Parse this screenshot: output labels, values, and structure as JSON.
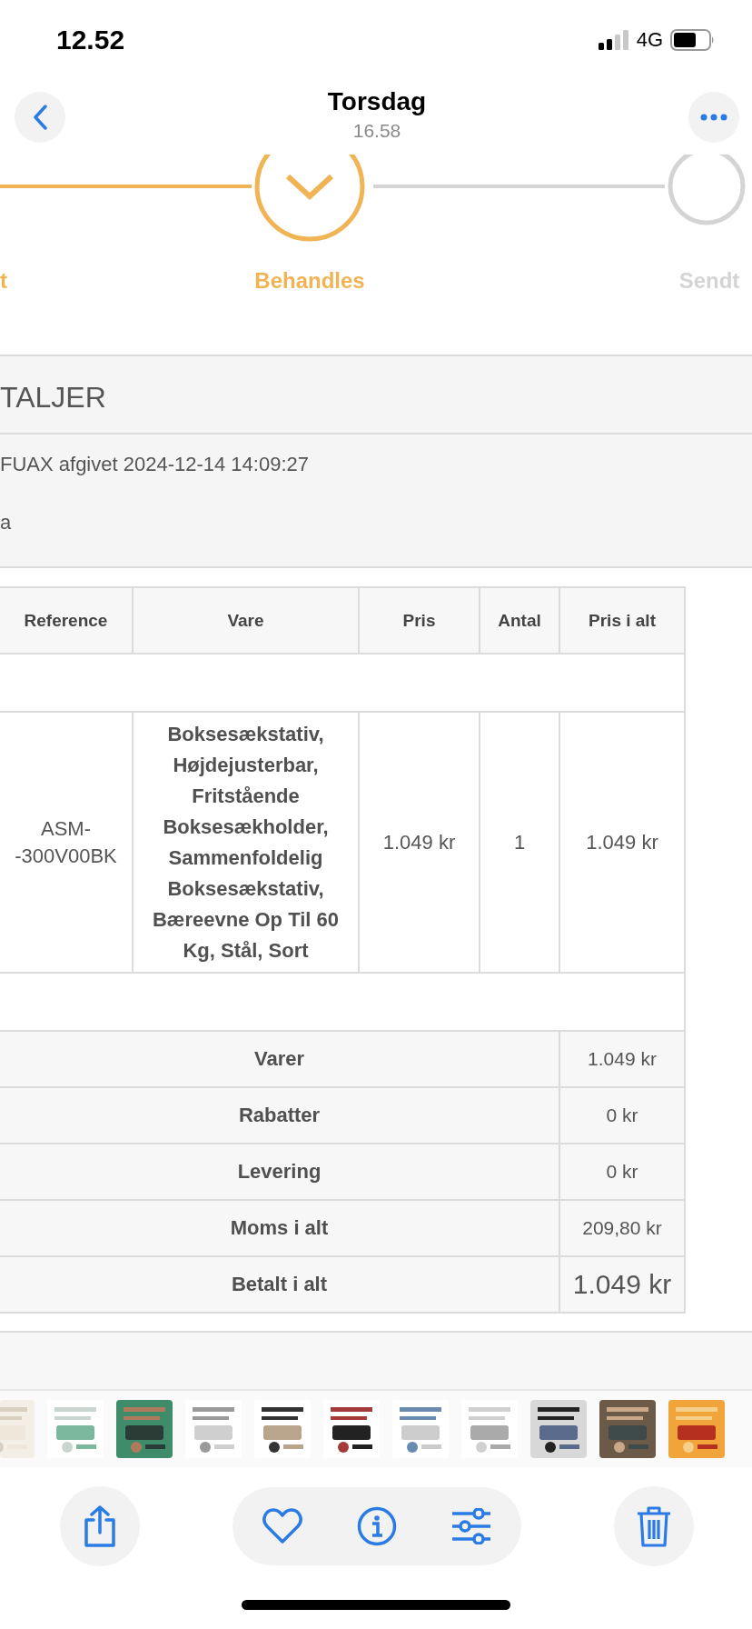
{
  "status_bar": {
    "time": "12.52",
    "network": "4G"
  },
  "header": {
    "title": "Torsdag",
    "subtitle": "16.58"
  },
  "progress": [
    {
      "label": "t",
      "completed": true
    },
    {
      "label": "Behandles",
      "completed": true
    },
    {
      "label": "Sendt",
      "completed": false
    }
  ],
  "details": {
    "title": "TALJER",
    "lines": [
      "FUAX afgivet 2024-12-14 14:09:27",
      "a"
    ]
  },
  "table": {
    "columns": [
      "Reference",
      "Vare",
      "Pris",
      "Antal",
      "Pris i alt"
    ],
    "rows": [
      {
        "reference": "ASM-\n-300V00BK",
        "item": "Boksesækstativ, Højdejusterbar, Fritstående Boksesækholder, Sammenfoldelig Boksesækstativ, Bæreevne Op Til 60 Kg, Stål, Sort",
        "price": "1.049 kr",
        "quantity": "1",
        "total": "1.049 kr"
      }
    ],
    "summary": [
      {
        "label": "Varer",
        "value": "1.049 kr",
        "kind": "normal"
      },
      {
        "label": "Rabatter",
        "value": "0 kr",
        "kind": "normal"
      },
      {
        "label": "Levering",
        "value": "0 kr",
        "kind": "normal"
      },
      {
        "label": "Moms i alt",
        "value": "209,80 kr",
        "kind": "normal"
      },
      {
        "label": "Betalt i alt",
        "value": "1.049 kr",
        "kind": "total"
      }
    ]
  },
  "toolbar": [
    {
      "kind": "share"
    },
    {
      "kind": "favorite"
    },
    {
      "kind": "info"
    },
    {
      "kind": "adjust"
    },
    {
      "kind": "delete"
    }
  ]
}
